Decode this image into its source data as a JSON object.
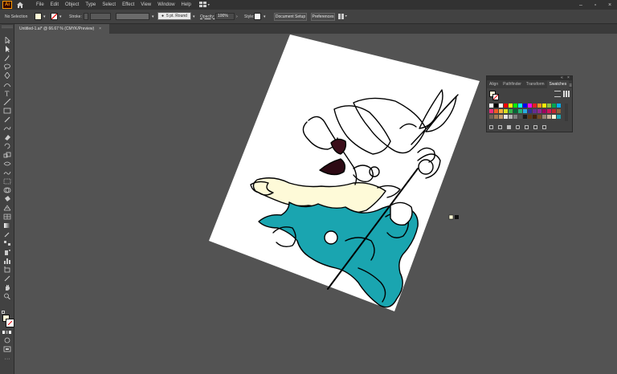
{
  "app": {
    "logo_text": "Ai",
    "menu": [
      "File",
      "Edit",
      "Object",
      "Type",
      "Select",
      "Effect",
      "View",
      "Window",
      "Help"
    ]
  },
  "control_bar": {
    "selection": "No Selection",
    "stroke_label": "Stroke:",
    "brush": "5 pt. Round",
    "opacity_label": "Opacity:",
    "opacity_value": "100%",
    "style_label": "Style:",
    "document_setup": "Document Setup",
    "preferences": "Preferences"
  },
  "document_tab": {
    "title": "Untitled-1.ai* @ 66.67 % (CMYK/Preview)",
    "close": "×"
  },
  "swatches_panel": {
    "tabs": [
      "Align",
      "Pathfinder",
      "Transform",
      "Swatches"
    ],
    "active_tab": "Swatches",
    "close": "×",
    "collapse": "«",
    "menu": "≡"
  },
  "colors": {
    "fill_swatch": "#fef9d6",
    "teal": "#1aa5b0",
    "cream": "#fefad8",
    "accent_orange": "#ff9a00"
  },
  "icons": [
    "home-icon",
    "workspace-icon",
    "selection-tool-icon",
    "pen-tool-icon",
    "type-tool-icon",
    "zoom-tool-icon",
    "hand-tool-icon"
  ]
}
